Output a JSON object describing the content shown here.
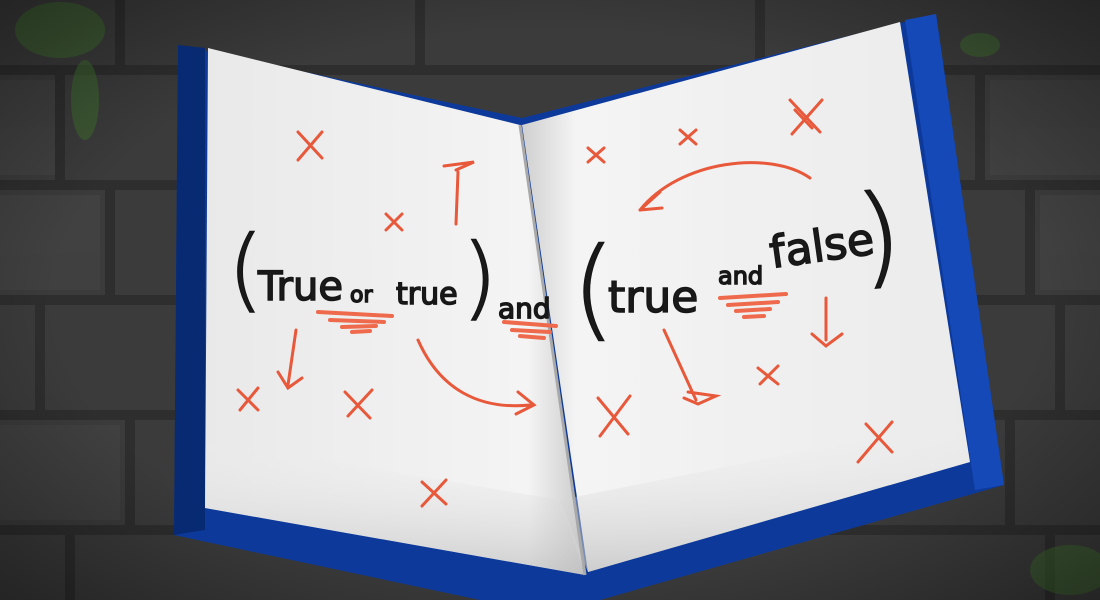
{
  "illustration": {
    "expression": {
      "open_paren_1": "(",
      "word_true_1": "True",
      "op_or": "or",
      "word_true_2": "true",
      "close_paren_1": ")",
      "op_and_main": "and",
      "open_paren_2": "(",
      "word_true_3": "true",
      "op_and_inner": "and",
      "word_false": "false",
      "close_paren_2": ")"
    },
    "colors": {
      "wall": "#3b3b3b",
      "brick_line": "#2c2c2c",
      "moss": "#3f6e2f",
      "cover": "#0d3a9a",
      "cover_edge": "#082a73",
      "page": "#f1f1f1",
      "page_shadow": "#cfcfcf",
      "ink": "#161616",
      "marks": "#e8583a",
      "underline": "#ef6a4c"
    }
  }
}
